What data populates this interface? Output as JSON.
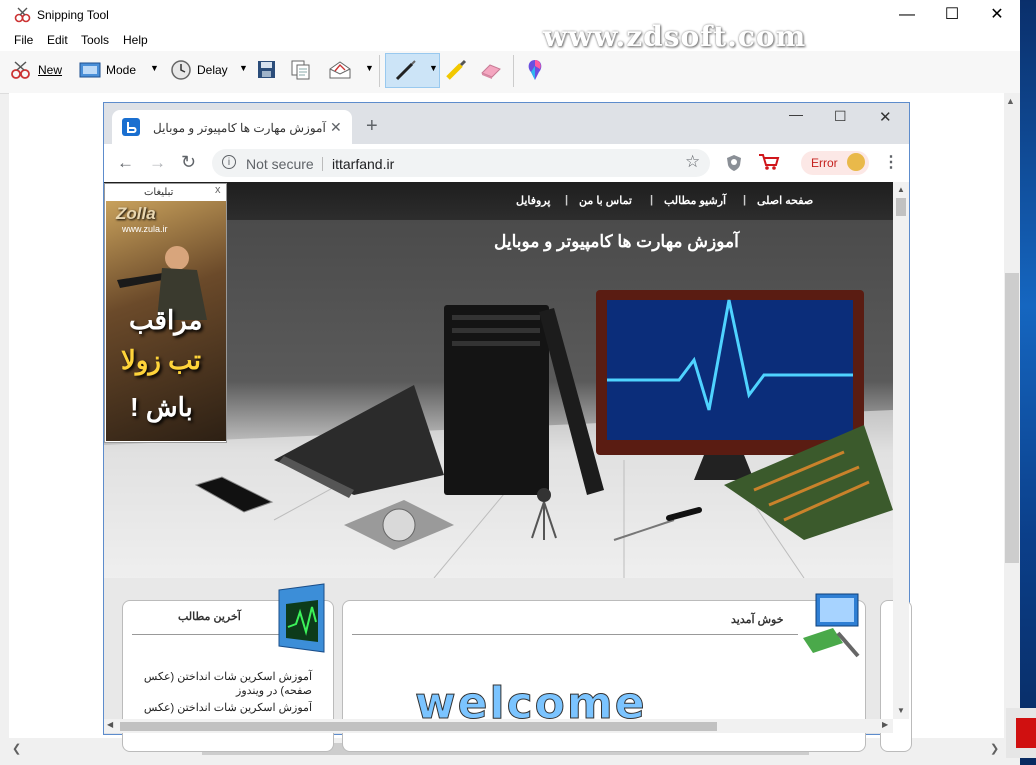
{
  "window": {
    "title": "Snipping Tool"
  },
  "menu": [
    "File",
    "Edit",
    "Tools",
    "Help"
  ],
  "toolbar": {
    "new_label": "New",
    "mode_label": "Mode",
    "delay_label": "Delay"
  },
  "watermark": "www.zdsoft.com",
  "browser": {
    "tab_title": "آموزش مهارت ها کامپیوتر و موبایل",
    "not_secure": "Not secure",
    "url": "ittarfand.ir",
    "error_label": "Error"
  },
  "site": {
    "nav": [
      "صفحه اصلی",
      "آرشیو مطالب",
      "تماس با من",
      "پروفایل"
    ],
    "nav_sep": "|",
    "hero_title": "آموزش مهارت ها کامپیوتر و موبایل",
    "ad": {
      "header": "تبلیغات",
      "close": "x",
      "logo": "Zolla",
      "site": "www.zula.ir",
      "line1": "مراقب",
      "line2": "تب زولا",
      "line3": "باش !"
    },
    "latest": {
      "title": "آخرین مطالب",
      "items": [
        "آموزش اسکرین شات انداختن (عکس صفحه) در ویندوز",
        "آموزش اسکرین شات انداختن (عکس"
      ]
    },
    "welcome": {
      "title": "خوش آمدید",
      "banner": "welcome"
    }
  },
  "colors": {
    "accent": "#0078d7",
    "chrome_frame": "#dee1e6",
    "error": "#c5221f"
  }
}
